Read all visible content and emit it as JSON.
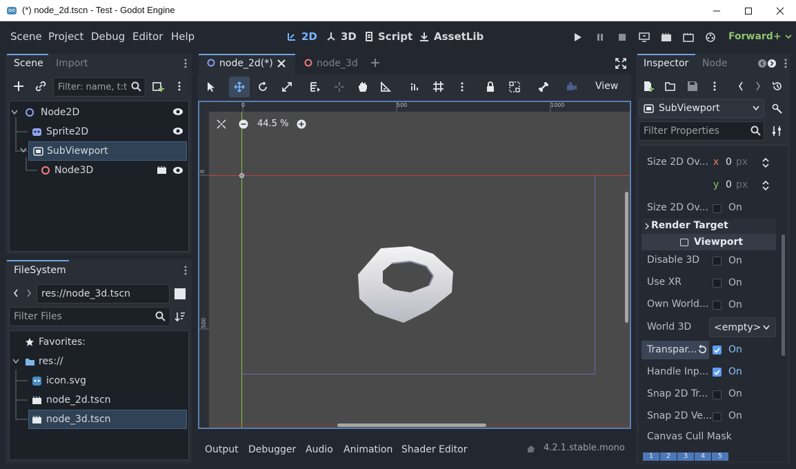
{
  "window": {
    "title": "(*) node_2d.tscn - Test - Godot Engine"
  },
  "menu": {
    "items": [
      "Scene",
      "Project",
      "Debug",
      "Editor",
      "Help"
    ]
  },
  "workspaces": {
    "w2d": "2D",
    "w3d": "3D",
    "script": "Script",
    "assetlib": "AssetLib"
  },
  "renderer": "Forward+",
  "scene_dock": {
    "tabs": [
      "Scene",
      "Import"
    ],
    "filter_placeholder": "Filter: name, t:t",
    "nodes": [
      "Node2D",
      "Sprite2D",
      "SubViewport",
      "Node3D"
    ]
  },
  "filesystem": {
    "title": "FileSystem",
    "path": "res://node_3d.tscn",
    "filter_placeholder": "Filter Files",
    "items": [
      "Favorites:",
      "res://",
      "icon.svg",
      "node_2d.tscn",
      "node_3d.tscn"
    ]
  },
  "editor_tabs": [
    "node_2d(*)",
    "node_3d"
  ],
  "viewport": {
    "view_label": "View",
    "zoom": "44.5 %",
    "ruler_marks": [
      "0",
      "500",
      "1000"
    ],
    "vruler_marks": [
      "0",
      "500"
    ]
  },
  "bottom_tabs": [
    "Output",
    "Debugger",
    "Audio",
    "Animation",
    "Shader Editor"
  ],
  "version": "4.2.1.stable.mono",
  "inspector": {
    "tabs": [
      "Inspector",
      "Node"
    ],
    "object": "SubViewport",
    "filter_placeholder": "Filter Properties",
    "size_label": "Size 2D Ov...",
    "x_label": "x",
    "x_value": "0",
    "y_label": "y",
    "y_value": "0",
    "unit": "px",
    "size_stretch_label": "Size 2D Ov...",
    "section_render_target": "Render Target",
    "section_viewport": "Viewport",
    "props": [
      {
        "label": "Disable 3D",
        "on": false
      },
      {
        "label": "Use XR",
        "on": false
      },
      {
        "label": "Own World...",
        "on": false
      }
    ],
    "world3d_label": "World 3D",
    "world3d_value": "<empty>",
    "props2": [
      {
        "label": "Transpar...",
        "on": true
      },
      {
        "label": "Handle Inp...",
        "on": true
      },
      {
        "label": "Snap 2D Tr...",
        "on": false
      },
      {
        "label": "Snap 2D Ve...",
        "on": false
      }
    ],
    "on_text": "On",
    "canvas_cull_label": "Canvas Cull Mask",
    "cull_bits": [
      "1",
      "2",
      "3",
      "4",
      "5"
    ]
  },
  "colors": {
    "accent": "#78b6ff",
    "panel": "#2a2e37",
    "viewport_bg": "#4a4a4a"
  }
}
